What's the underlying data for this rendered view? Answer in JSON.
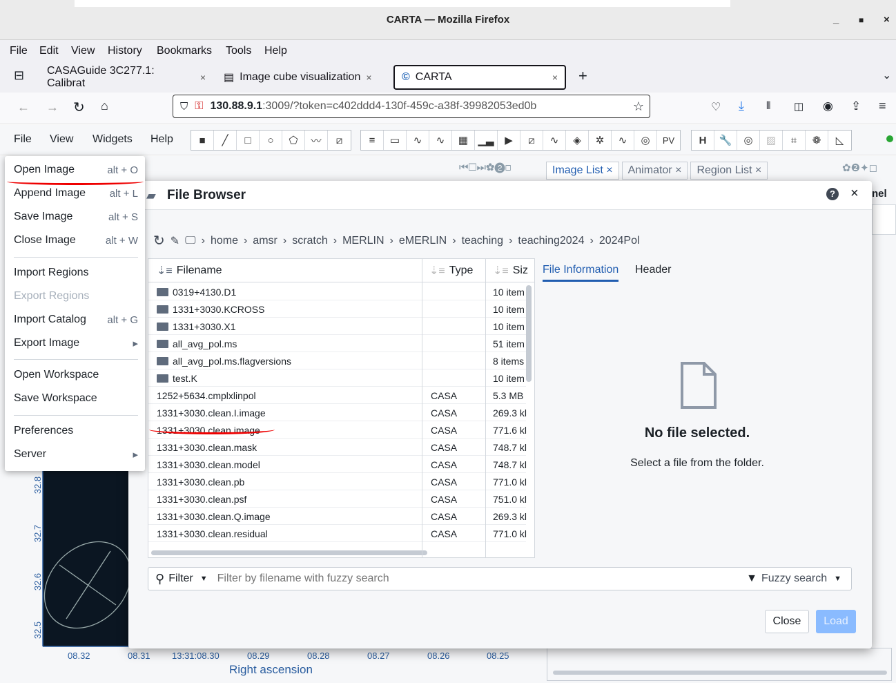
{
  "window": {
    "title": "CARTA — Mozilla Firefox",
    "min": "_",
    "max": "▫",
    "close": "×"
  },
  "firefox_menu": [
    "File",
    "Edit",
    "View",
    "History",
    "Bookmarks",
    "Tools",
    "Help"
  ],
  "tabs": [
    {
      "label": "CASAGuide 3C277.1: Calibrat",
      "close": "×"
    },
    {
      "label": "Image cube visualization",
      "close": "×"
    },
    {
      "label": "CARTA",
      "close": "×"
    }
  ],
  "new_tab": "+",
  "url": {
    "host": "130.88.9.1",
    "rest": ":3009/?token=c402ddd4-130f-459c-a38f-39982053ed0b"
  },
  "carta_menu": [
    "File",
    "View",
    "Widgets",
    "Help"
  ],
  "toolbar_pv": "PV",
  "file_menu": {
    "items": [
      {
        "label": "Open Image",
        "shortcut": "alt + O"
      },
      {
        "label": "Append Image",
        "shortcut": "alt + L"
      },
      {
        "label": "Save Image",
        "shortcut": "alt + S"
      },
      {
        "label": "Close Image",
        "shortcut": "alt + W"
      },
      {
        "label": "Import Regions",
        "shortcut": ""
      },
      {
        "label": "Export Regions",
        "shortcut": "",
        "disabled": true
      },
      {
        "label": "Import Catalog",
        "shortcut": "alt + G"
      },
      {
        "label": "Export Image",
        "shortcut": "▸"
      },
      {
        "label": "Open Workspace",
        "shortcut": ""
      },
      {
        "label": "Save Workspace",
        "shortcut": ""
      },
      {
        "label": "Preferences",
        "shortcut": ""
      },
      {
        "label": "Server",
        "shortcut": "▸"
      }
    ]
  },
  "right_tabs": [
    "Image List",
    "Animator",
    "Region List"
  ],
  "right_fragment": "nel",
  "file_browser": {
    "title": "File Browser",
    "breadcrumb": [
      "home",
      "amsr",
      "scratch",
      "MERLIN",
      "eMERLIN",
      "teaching",
      "teaching2024",
      "2024Pol"
    ],
    "columns": {
      "name": "Filename",
      "type": "Type",
      "size": "Siz"
    },
    "files": [
      {
        "name": "0319+4130.D1",
        "type": "",
        "size": "10 item",
        "folder": true
      },
      {
        "name": "1331+3030.KCROSS",
        "type": "",
        "size": "10 item",
        "folder": true
      },
      {
        "name": "1331+3030.X1",
        "type": "",
        "size": "10 item",
        "folder": true
      },
      {
        "name": "all_avg_pol.ms",
        "type": "",
        "size": "51 item",
        "folder": true
      },
      {
        "name": "all_avg_pol.ms.flagversions",
        "type": "",
        "size": "8 items",
        "folder": true
      },
      {
        "name": "test.K",
        "type": "",
        "size": "10 item",
        "folder": true
      },
      {
        "name": "1252+5634.cmplxlinpol",
        "type": "CASA",
        "size": "5.3 MB",
        "folder": false
      },
      {
        "name": "1331+3030.clean.I.image",
        "type": "CASA",
        "size": "269.3 kl",
        "folder": false
      },
      {
        "name": "1331+3030.clean.image",
        "type": "CASA",
        "size": "771.6 kl",
        "folder": false
      },
      {
        "name": "1331+3030.clean.mask",
        "type": "CASA",
        "size": "748.7 kl",
        "folder": false
      },
      {
        "name": "1331+3030.clean.model",
        "type": "CASA",
        "size": "748.7 kl",
        "folder": false
      },
      {
        "name": "1331+3030.clean.pb",
        "type": "CASA",
        "size": "771.0 kl",
        "folder": false
      },
      {
        "name": "1331+3030.clean.psf",
        "type": "CASA",
        "size": "751.0 kl",
        "folder": false
      },
      {
        "name": "1331+3030.clean.Q.image",
        "type": "CASA",
        "size": "269.3 kl",
        "folder": false
      },
      {
        "name": "1331+3030.clean.residual",
        "type": "CASA",
        "size": "771.0 kl",
        "folder": false
      }
    ],
    "info_tabs": [
      "File Information",
      "Header"
    ],
    "empty_title": "No file selected.",
    "empty_sub": "Select a file from the folder.",
    "filter_label": "Filter",
    "filter_placeholder": "Filter by filename with fuzzy search",
    "fuzzy_label": "Fuzzy search",
    "close_btn": "Close",
    "load_btn": "Load"
  },
  "image_view": {
    "y_ticks": [
      "32.8",
      "32.7",
      "32.6",
      "32.5"
    ],
    "x_ticks": [
      "08.32",
      "08.31",
      "13:31:08.30",
      "08.29",
      "08.28",
      "08.27",
      "08.26",
      "08.25"
    ],
    "x_label": "Right ascension"
  }
}
